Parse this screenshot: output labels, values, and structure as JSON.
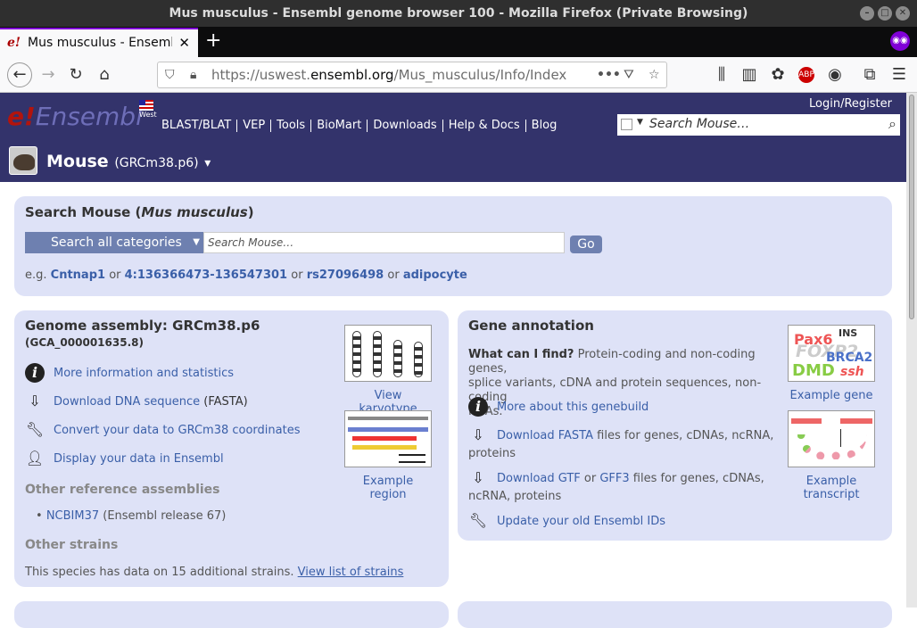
{
  "window": {
    "title": "Mus musculus - Ensembl genome browser 100 - Mozilla Firefox (Private Browsing)"
  },
  "tab": {
    "label": "Mus musculus - Ensembl",
    "favicon": "e!"
  },
  "address": {
    "url_prefix": "https://uswest.",
    "url_domain": "ensembl.org",
    "url_path": "/Mus_musculus/Info/Index"
  },
  "header": {
    "logo_e": "e!",
    "logo_text": "Ensembl",
    "region": "West",
    "nav": [
      "BLAST/BLAT",
      "VEP",
      "Tools",
      "BioMart",
      "Downloads",
      "Help & Docs",
      "Blog"
    ],
    "login": "Login/Register",
    "search_placeholder": "Search Mouse…",
    "species_name": "Mouse",
    "species_assembly": "(GRCm38.p6)",
    "species_caret": "▾"
  },
  "search_panel": {
    "title_prefix": "Search Mouse (",
    "title_italic": "Mus musculus",
    "title_suffix": ")",
    "category": "Search all categories",
    "input_placeholder": "Search Mouse…",
    "go": "Go",
    "eg_prefix": "e.g.",
    "examples": [
      "Cntnap1",
      "4:136366473-136547301",
      "rs27096498",
      "adipocyte"
    ],
    "or": "or"
  },
  "genome_panel": {
    "title": "Genome assembly: GRCm38.p6",
    "accession": "(GCA_000001635.8)",
    "links": [
      {
        "icon": "info-icon",
        "text": "More information and statistics"
      },
      {
        "icon": "download-icon",
        "text": "Download DNA sequence",
        "suffix": " (FASTA)"
      },
      {
        "icon": "wrench-icon",
        "text": "Convert your data to GRCm38 coordinates"
      },
      {
        "icon": "user-data-icon",
        "text": "Display your data in Ensembl"
      }
    ],
    "karyotype_caption": "View karyotype",
    "region_caption": "Example region",
    "other_ref_heading": "Other reference assemblies",
    "ncbi_link": "NCBIM37",
    "ncbi_suffix": " (Ensembl release 67)",
    "other_strains_heading": "Other strains",
    "strains_text": "This species has data on 15 additional strains. ",
    "strains_link": "View list of strains"
  },
  "gene_panel": {
    "title": "Gene annotation",
    "what_label": "What can I find?",
    "what_text_1": " Protein-coding and non-coding genes,",
    "what_text_2": "splice variants, cDNA and protein sequences, non-coding",
    "what_text_3": "RNAs.",
    "genebuild_link": "More about this genebuild",
    "fasta_link": "Download FASTA",
    "fasta_text_1": " files for genes, cDNAs, ncRNA,",
    "fasta_text_2": "proteins",
    "gtf_link": "Download GTF",
    "gtf_or": " or ",
    "gff_link": "GFF3",
    "gtf_text_1": " files for genes, cDNAs,",
    "gtf_text_2": "ncRNA, proteins",
    "update_link": "Update your old Ensembl IDs",
    "gene_caption": "Example gene",
    "transcript_caption": "Example transcript",
    "gene_words": [
      "Pax6",
      "INS",
      "FOXP2",
      "BRCA2",
      "DMD",
      "ssh"
    ]
  }
}
